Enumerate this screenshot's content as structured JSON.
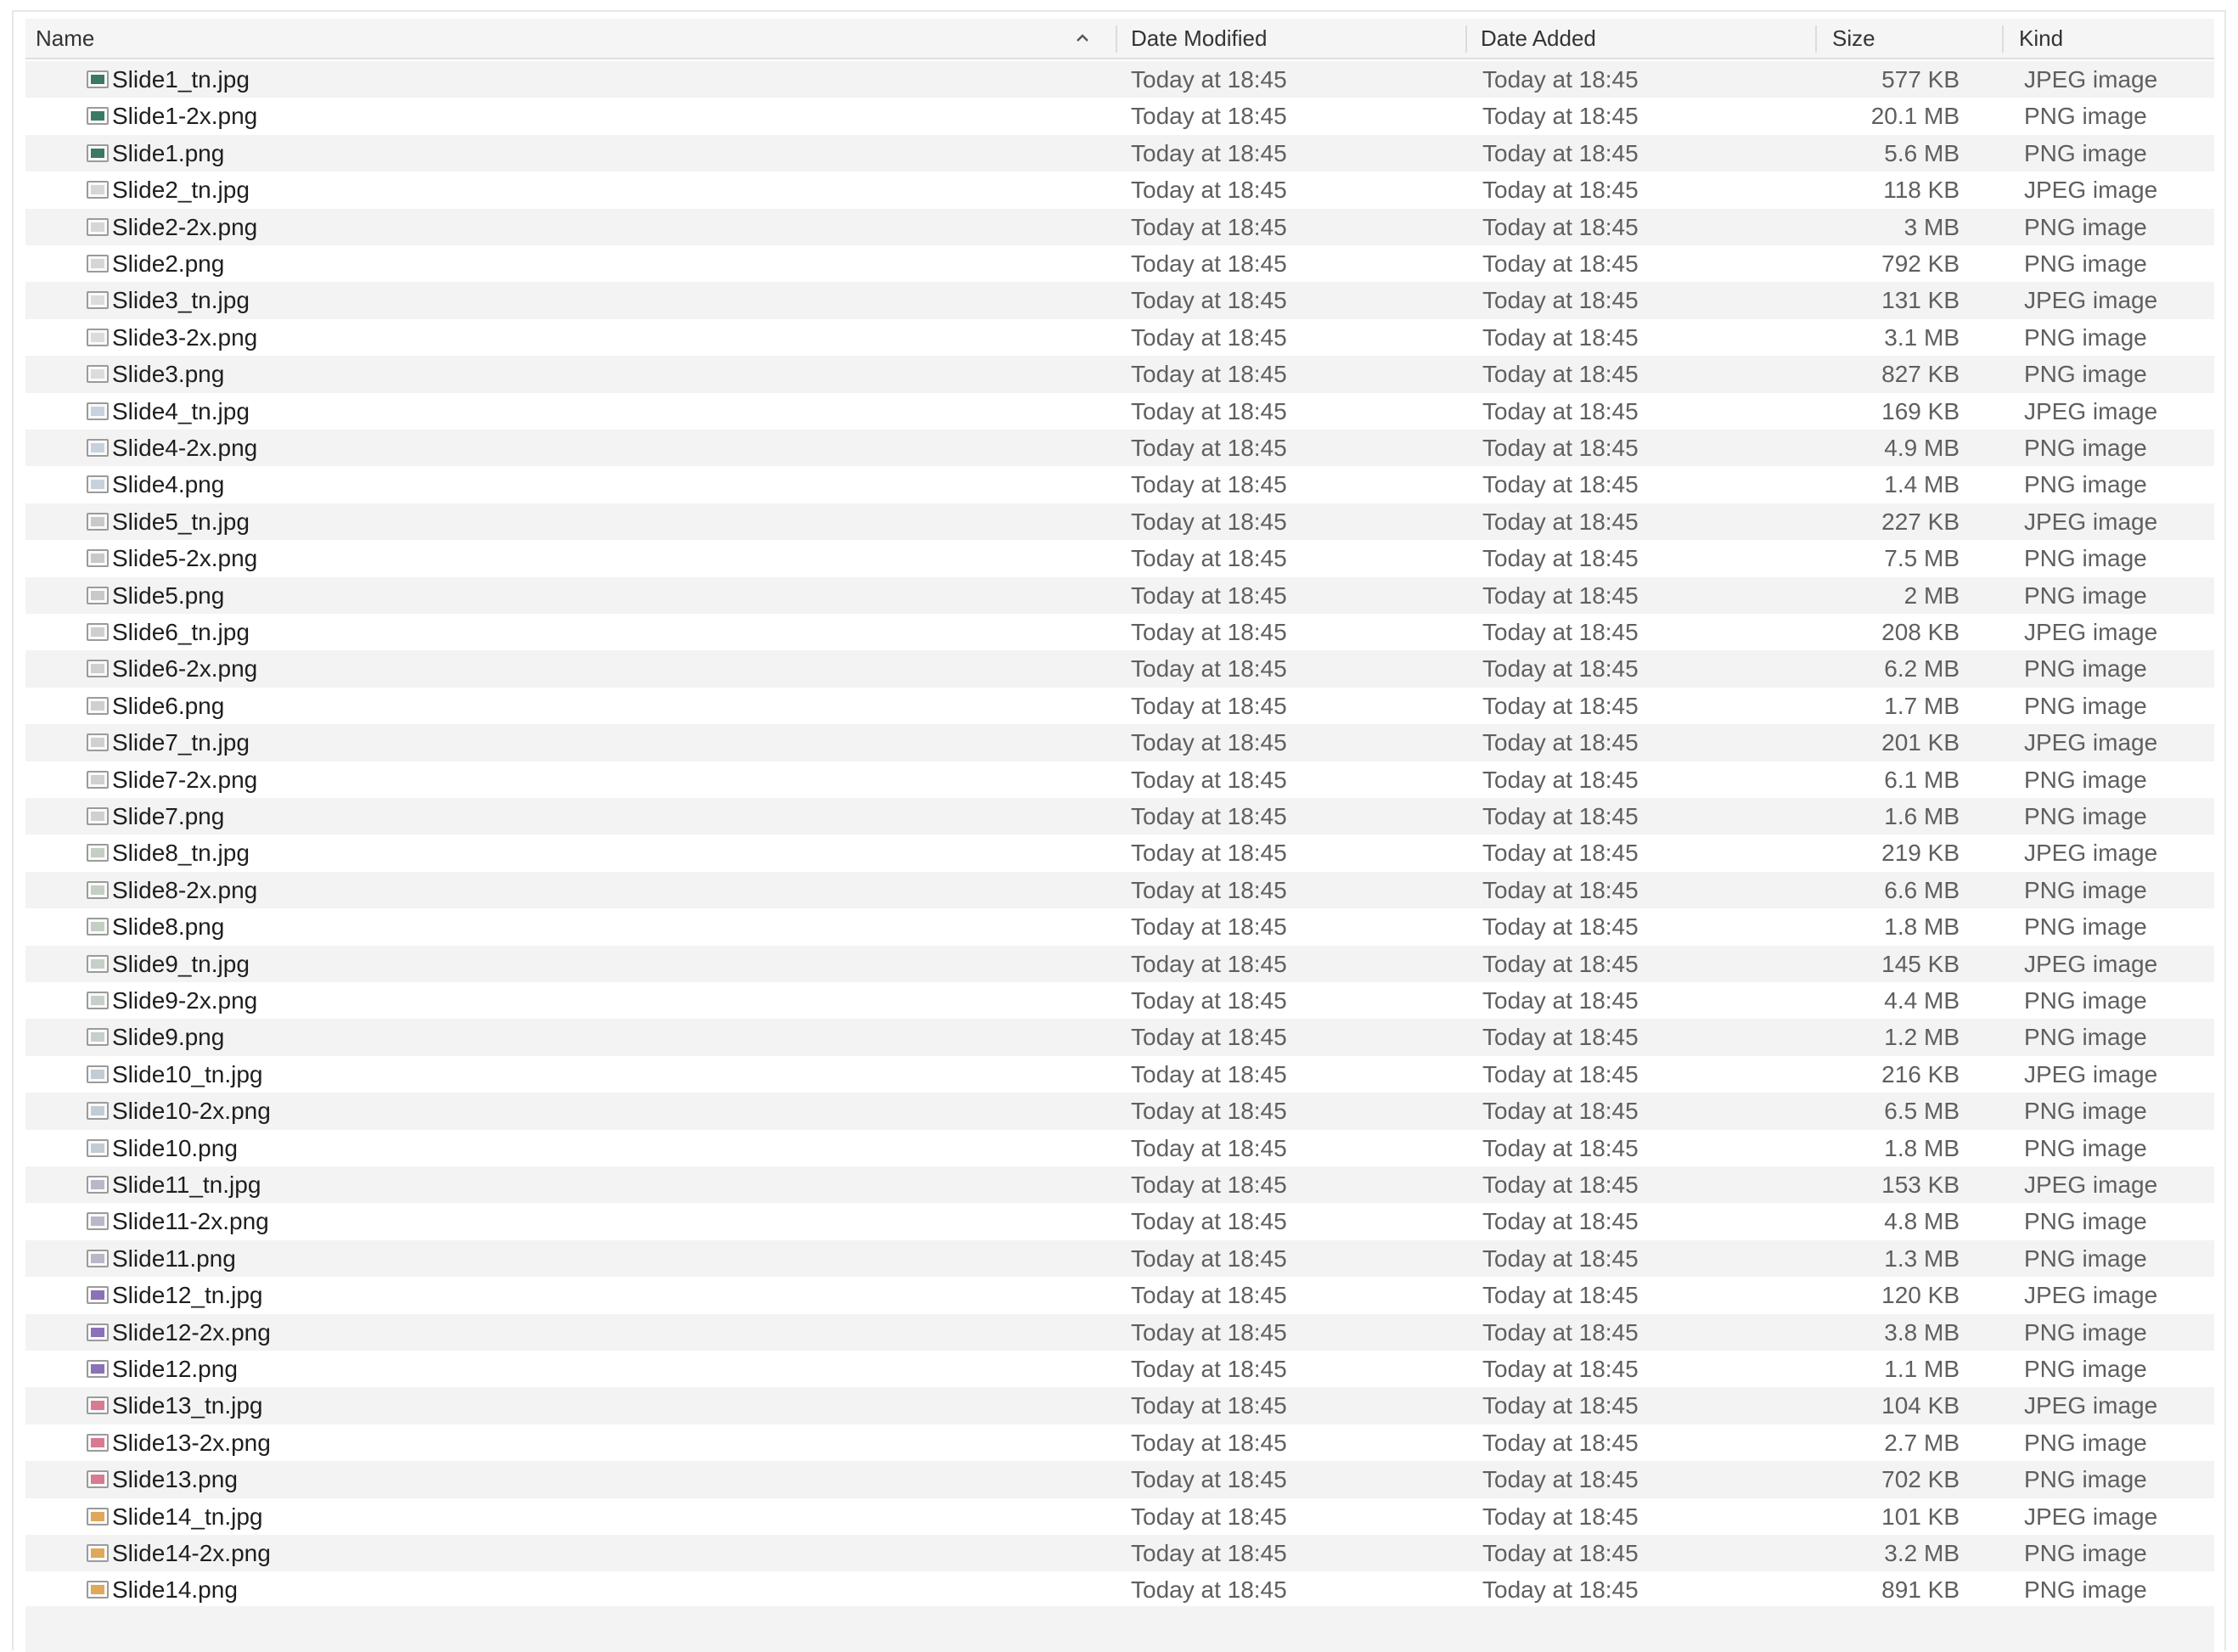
{
  "columns": {
    "name": "Name",
    "date_modified": "Date Modified",
    "date_added": "Date Added",
    "size": "Size",
    "kind": "Kind"
  },
  "sort": {
    "column": "name",
    "direction": "ascending",
    "icon": "chevron-up-icon"
  },
  "files": [
    {
      "name": "Slide1_tn.jpg",
      "modified": "Today at 18:45",
      "added": "Today at 18:45",
      "size": "577 KB",
      "kind": "JPEG image",
      "icon_color": "#3a7a62"
    },
    {
      "name": "Slide1-2x.png",
      "modified": "Today at 18:45",
      "added": "Today at 18:45",
      "size": "20.1 MB",
      "kind": "PNG image",
      "icon_color": "#3a7a62"
    },
    {
      "name": "Slide1.png",
      "modified": "Today at 18:45",
      "added": "Today at 18:45",
      "size": "5.6 MB",
      "kind": "PNG image",
      "icon_color": "#3a7a62"
    },
    {
      "name": "Slide2_tn.jpg",
      "modified": "Today at 18:45",
      "added": "Today at 18:45",
      "size": "118 KB",
      "kind": "JPEG image",
      "icon_color": "#d6d6d6"
    },
    {
      "name": "Slide2-2x.png",
      "modified": "Today at 18:45",
      "added": "Today at 18:45",
      "size": "3 MB",
      "kind": "PNG image",
      "icon_color": "#d6d6d6"
    },
    {
      "name": "Slide2.png",
      "modified": "Today at 18:45",
      "added": "Today at 18:45",
      "size": "792 KB",
      "kind": "PNG image",
      "icon_color": "#d6d6d6"
    },
    {
      "name": "Slide3_tn.jpg",
      "modified": "Today at 18:45",
      "added": "Today at 18:45",
      "size": "131 KB",
      "kind": "JPEG image",
      "icon_color": "#dcdcdc"
    },
    {
      "name": "Slide3-2x.png",
      "modified": "Today at 18:45",
      "added": "Today at 18:45",
      "size": "3.1 MB",
      "kind": "PNG image",
      "icon_color": "#dcdcdc"
    },
    {
      "name": "Slide3.png",
      "modified": "Today at 18:45",
      "added": "Today at 18:45",
      "size": "827 KB",
      "kind": "PNG image",
      "icon_color": "#dcdcdc"
    },
    {
      "name": "Slide4_tn.jpg",
      "modified": "Today at 18:45",
      "added": "Today at 18:45",
      "size": "169 KB",
      "kind": "JPEG image",
      "icon_color": "#c8d2dc"
    },
    {
      "name": "Slide4-2x.png",
      "modified": "Today at 18:45",
      "added": "Today at 18:45",
      "size": "4.9 MB",
      "kind": "PNG image",
      "icon_color": "#c8d2dc"
    },
    {
      "name": "Slide4.png",
      "modified": "Today at 18:45",
      "added": "Today at 18:45",
      "size": "1.4 MB",
      "kind": "PNG image",
      "icon_color": "#c8d2dc"
    },
    {
      "name": "Slide5_tn.jpg",
      "modified": "Today at 18:45",
      "added": "Today at 18:45",
      "size": "227 KB",
      "kind": "JPEG image",
      "icon_color": "#c9c9c9"
    },
    {
      "name": "Slide5-2x.png",
      "modified": "Today at 18:45",
      "added": "Today at 18:45",
      "size": "7.5 MB",
      "kind": "PNG image",
      "icon_color": "#c9c9c9"
    },
    {
      "name": "Slide5.png",
      "modified": "Today at 18:45",
      "added": "Today at 18:45",
      "size": "2 MB",
      "kind": "PNG image",
      "icon_color": "#c9c9c9"
    },
    {
      "name": "Slide6_tn.jpg",
      "modified": "Today at 18:45",
      "added": "Today at 18:45",
      "size": "208 KB",
      "kind": "JPEG image",
      "icon_color": "#cfcfcf"
    },
    {
      "name": "Slide6-2x.png",
      "modified": "Today at 18:45",
      "added": "Today at 18:45",
      "size": "6.2 MB",
      "kind": "PNG image",
      "icon_color": "#cfcfcf"
    },
    {
      "name": "Slide6.png",
      "modified": "Today at 18:45",
      "added": "Today at 18:45",
      "size": "1.7 MB",
      "kind": "PNG image",
      "icon_color": "#cfcfcf"
    },
    {
      "name": "Slide7_tn.jpg",
      "modified": "Today at 18:45",
      "added": "Today at 18:45",
      "size": "201 KB",
      "kind": "JPEG image",
      "icon_color": "#d0d0d0"
    },
    {
      "name": "Slide7-2x.png",
      "modified": "Today at 18:45",
      "added": "Today at 18:45",
      "size": "6.1 MB",
      "kind": "PNG image",
      "icon_color": "#d0d0d0"
    },
    {
      "name": "Slide7.png",
      "modified": "Today at 18:45",
      "added": "Today at 18:45",
      "size": "1.6 MB",
      "kind": "PNG image",
      "icon_color": "#d0d0d0"
    },
    {
      "name": "Slide8_tn.jpg",
      "modified": "Today at 18:45",
      "added": "Today at 18:45",
      "size": "219 KB",
      "kind": "JPEG image",
      "icon_color": "#c4cfc4"
    },
    {
      "name": "Slide8-2x.png",
      "modified": "Today at 18:45",
      "added": "Today at 18:45",
      "size": "6.6 MB",
      "kind": "PNG image",
      "icon_color": "#c4cfc4"
    },
    {
      "name": "Slide8.png",
      "modified": "Today at 18:45",
      "added": "Today at 18:45",
      "size": "1.8 MB",
      "kind": "PNG image",
      "icon_color": "#c4cfc4"
    },
    {
      "name": "Slide9_tn.jpg",
      "modified": "Today at 18:45",
      "added": "Today at 18:45",
      "size": "145 KB",
      "kind": "JPEG image",
      "icon_color": "#c6d0c8"
    },
    {
      "name": "Slide9-2x.png",
      "modified": "Today at 18:45",
      "added": "Today at 18:45",
      "size": "4.4 MB",
      "kind": "PNG image",
      "icon_color": "#c6d0c8"
    },
    {
      "name": "Slide9.png",
      "modified": "Today at 18:45",
      "added": "Today at 18:45",
      "size": "1.2 MB",
      "kind": "PNG image",
      "icon_color": "#c6d0c8"
    },
    {
      "name": "Slide10_tn.jpg",
      "modified": "Today at 18:45",
      "added": "Today at 18:45",
      "size": "216 KB",
      "kind": "JPEG image",
      "icon_color": "#c2ccd4"
    },
    {
      "name": "Slide10-2x.png",
      "modified": "Today at 18:45",
      "added": "Today at 18:45",
      "size": "6.5 MB",
      "kind": "PNG image",
      "icon_color": "#c2ccd4"
    },
    {
      "name": "Slide10.png",
      "modified": "Today at 18:45",
      "added": "Today at 18:45",
      "size": "1.8 MB",
      "kind": "PNG image",
      "icon_color": "#c2ccd4"
    },
    {
      "name": "Slide11_tn.jpg",
      "modified": "Today at 18:45",
      "added": "Today at 18:45",
      "size": "153 KB",
      "kind": "JPEG image",
      "icon_color": "#b8b8c8"
    },
    {
      "name": "Slide11-2x.png",
      "modified": "Today at 18:45",
      "added": "Today at 18:45",
      "size": "4.8 MB",
      "kind": "PNG image",
      "icon_color": "#b8b8c8"
    },
    {
      "name": "Slide11.png",
      "modified": "Today at 18:45",
      "added": "Today at 18:45",
      "size": "1.3 MB",
      "kind": "PNG image",
      "icon_color": "#b8b8c8"
    },
    {
      "name": "Slide12_tn.jpg",
      "modified": "Today at 18:45",
      "added": "Today at 18:45",
      "size": "120 KB",
      "kind": "JPEG image",
      "icon_color": "#8a72b8"
    },
    {
      "name": "Slide12-2x.png",
      "modified": "Today at 18:45",
      "added": "Today at 18:45",
      "size": "3.8 MB",
      "kind": "PNG image",
      "icon_color": "#8a72b8"
    },
    {
      "name": "Slide12.png",
      "modified": "Today at 18:45",
      "added": "Today at 18:45",
      "size": "1.1 MB",
      "kind": "PNG image",
      "icon_color": "#8a72b8"
    },
    {
      "name": "Slide13_tn.jpg",
      "modified": "Today at 18:45",
      "added": "Today at 18:45",
      "size": "104 KB",
      "kind": "JPEG image",
      "icon_color": "#d87a92"
    },
    {
      "name": "Slide13-2x.png",
      "modified": "Today at 18:45",
      "added": "Today at 18:45",
      "size": "2.7 MB",
      "kind": "PNG image",
      "icon_color": "#d87a92"
    },
    {
      "name": "Slide13.png",
      "modified": "Today at 18:45",
      "added": "Today at 18:45",
      "size": "702 KB",
      "kind": "PNG image",
      "icon_color": "#d87a92"
    },
    {
      "name": "Slide14_tn.jpg",
      "modified": "Today at 18:45",
      "added": "Today at 18:45",
      "size": "101 KB",
      "kind": "JPEG image",
      "icon_color": "#e0a85a"
    },
    {
      "name": "Slide14-2x.png",
      "modified": "Today at 18:45",
      "added": "Today at 18:45",
      "size": "3.2 MB",
      "kind": "PNG image",
      "icon_color": "#e0a85a"
    },
    {
      "name": "Slide14.png",
      "modified": "Today at 18:45",
      "added": "Today at 18:45",
      "size": "891 KB",
      "kind": "PNG image",
      "icon_color": "#e0a85a"
    }
  ]
}
